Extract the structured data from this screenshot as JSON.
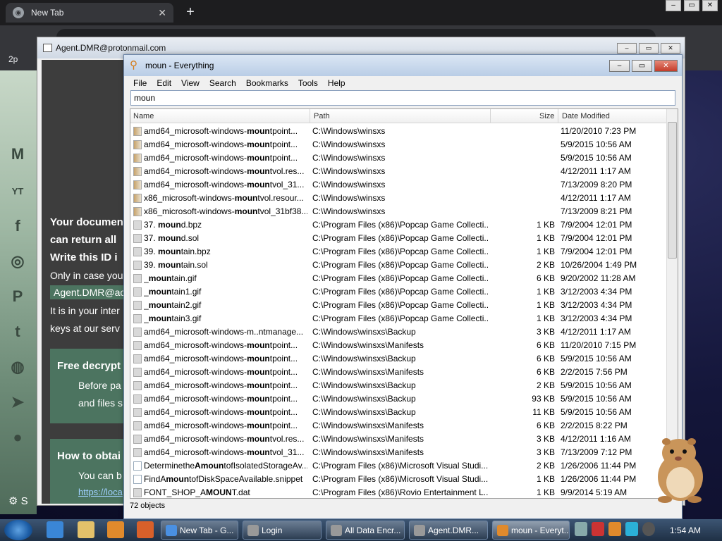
{
  "browser": {
    "tab_title": "New Tab",
    "bookmark_label": "2p"
  },
  "background_page": {
    "settings_label": "S",
    "lines": [
      "Your documen",
      "can return all",
      "Write this ID i",
      "Only in case you",
      "Agent.DMR@ao",
      "It is in your inter",
      "keys at our serv"
    ],
    "free_box": {
      "title": "Free decrypt",
      "line1": "Before pa",
      "line2": "and files s"
    },
    "how_box": {
      "title": "How to obtai",
      "line1": "You can b",
      "line2": "https://loca"
    }
  },
  "agent_window": {
    "title": "Agent.DMR@protonmail.com"
  },
  "everything": {
    "title": "moun - Everything",
    "menu": [
      "File",
      "Edit",
      "View",
      "Search",
      "Bookmarks",
      "Tools",
      "Help"
    ],
    "search_value": "moun",
    "columns": {
      "name": "Name",
      "path": "Path",
      "size": "Size",
      "date": "Date Modified"
    },
    "rows": [
      {
        "pre": "amd64_microsoft-windows-",
        "hit": "moun",
        "post": "tpoint...",
        "path": "C:\\Windows\\winsxs",
        "size": "",
        "date": "11/20/2010 7:23 PM",
        "icon": "dll"
      },
      {
        "pre": "amd64_microsoft-windows-",
        "hit": "moun",
        "post": "tpoint...",
        "path": "C:\\Windows\\winsxs",
        "size": "",
        "date": "5/9/2015 10:56 AM",
        "icon": "dll"
      },
      {
        "pre": "amd64_microsoft-windows-",
        "hit": "moun",
        "post": "tpoint...",
        "path": "C:\\Windows\\winsxs",
        "size": "",
        "date": "5/9/2015 10:56 AM",
        "icon": "dll"
      },
      {
        "pre": "amd64_microsoft-windows-",
        "hit": "moun",
        "post": "tvol.res...",
        "path": "C:\\Windows\\winsxs",
        "size": "",
        "date": "4/12/2011 1:17 AM",
        "icon": "dll"
      },
      {
        "pre": "amd64_microsoft-windows-",
        "hit": "moun",
        "post": "tvol_31...",
        "path": "C:\\Windows\\winsxs",
        "size": "",
        "date": "7/13/2009 8:20 PM",
        "icon": "dll"
      },
      {
        "pre": "x86_microsoft-windows-",
        "hit": "moun",
        "post": "tvol.resour...",
        "path": "C:\\Windows\\winsxs",
        "size": "",
        "date": "4/12/2011 1:17 AM",
        "icon": "dll"
      },
      {
        "pre": "x86_microsoft-windows-",
        "hit": "moun",
        "post": "tvol_31bf38...",
        "path": "C:\\Windows\\winsxs",
        "size": "",
        "date": "7/13/2009 8:21 PM",
        "icon": "dll"
      },
      {
        "pre": "37. ",
        "hit": "moun",
        "post": "d.bpz",
        "path": "C:\\Program Files (x86)\\Popcap Game Collecti...",
        "size": "1 KB",
        "date": "7/9/2004 12:01 PM",
        "icon": "file"
      },
      {
        "pre": "37. ",
        "hit": "moun",
        "post": "d.sol",
        "path": "C:\\Program Files (x86)\\Popcap Game Collecti...",
        "size": "1 KB",
        "date": "7/9/2004 12:01 PM",
        "icon": "file"
      },
      {
        "pre": "39. ",
        "hit": "moun",
        "post": "tain.bpz",
        "path": "C:\\Program Files (x86)\\Popcap Game Collecti...",
        "size": "1 KB",
        "date": "7/9/2004 12:01 PM",
        "icon": "file"
      },
      {
        "pre": "39. ",
        "hit": "moun",
        "post": "tain.sol",
        "path": "C:\\Program Files (x86)\\Popcap Game Collecti...",
        "size": "2 KB",
        "date": "10/26/2004 1:49 PM",
        "icon": "file"
      },
      {
        "pre": "_",
        "hit": "moun",
        "post": "tain.gif",
        "path": "C:\\Program Files (x86)\\Popcap Game Collecti...",
        "size": "6 KB",
        "date": "9/20/2002 11:28 AM",
        "icon": "file"
      },
      {
        "pre": "_",
        "hit": "moun",
        "post": "tain1.gif",
        "path": "C:\\Program Files (x86)\\Popcap Game Collecti...",
        "size": "1 KB",
        "date": "3/12/2003 4:34 PM",
        "icon": "file"
      },
      {
        "pre": "_",
        "hit": "moun",
        "post": "tain2.gif",
        "path": "C:\\Program Files (x86)\\Popcap Game Collecti...",
        "size": "1 KB",
        "date": "3/12/2003 4:34 PM",
        "icon": "file"
      },
      {
        "pre": "_",
        "hit": "moun",
        "post": "tain3.gif",
        "path": "C:\\Program Files (x86)\\Popcap Game Collecti...",
        "size": "1 KB",
        "date": "3/12/2003 4:34 PM",
        "icon": "file"
      },
      {
        "pre": "amd64_microsoft-windows-m..ntmanage...",
        "hit": "",
        "post": "",
        "path": "C:\\Windows\\winsxs\\Backup",
        "size": "3 KB",
        "date": "4/12/2011 1:17 AM",
        "icon": "file"
      },
      {
        "pre": "amd64_microsoft-windows-",
        "hit": "moun",
        "post": "tpoint...",
        "path": "C:\\Windows\\winsxs\\Manifests",
        "size": "6 KB",
        "date": "11/20/2010 7:15 PM",
        "icon": "file"
      },
      {
        "pre": "amd64_microsoft-windows-",
        "hit": "moun",
        "post": "tpoint...",
        "path": "C:\\Windows\\winsxs\\Backup",
        "size": "6 KB",
        "date": "5/9/2015 10:56 AM",
        "icon": "file"
      },
      {
        "pre": "amd64_microsoft-windows-",
        "hit": "moun",
        "post": "tpoint...",
        "path": "C:\\Windows\\winsxs\\Manifests",
        "size": "6 KB",
        "date": "2/2/2015 7:56 PM",
        "icon": "file"
      },
      {
        "pre": "amd64_microsoft-windows-",
        "hit": "moun",
        "post": "tpoint...",
        "path": "C:\\Windows\\winsxs\\Backup",
        "size": "2 KB",
        "date": "5/9/2015 10:56 AM",
        "icon": "file"
      },
      {
        "pre": "amd64_microsoft-windows-",
        "hit": "moun",
        "post": "tpoint...",
        "path": "C:\\Windows\\winsxs\\Backup",
        "size": "93 KB",
        "date": "5/9/2015 10:56 AM",
        "icon": "file"
      },
      {
        "pre": "amd64_microsoft-windows-",
        "hit": "moun",
        "post": "tpoint...",
        "path": "C:\\Windows\\winsxs\\Backup",
        "size": "11 KB",
        "date": "5/9/2015 10:56 AM",
        "icon": "file"
      },
      {
        "pre": "amd64_microsoft-windows-",
        "hit": "moun",
        "post": "tpoint...",
        "path": "C:\\Windows\\winsxs\\Manifests",
        "size": "6 KB",
        "date": "2/2/2015 8:22 PM",
        "icon": "file"
      },
      {
        "pre": "amd64_microsoft-windows-",
        "hit": "moun",
        "post": "tvol.res...",
        "path": "C:\\Windows\\winsxs\\Manifests",
        "size": "3 KB",
        "date": "4/12/2011 1:16 AM",
        "icon": "file"
      },
      {
        "pre": "amd64_microsoft-windows-",
        "hit": "moun",
        "post": "tvol_31...",
        "path": "C:\\Windows\\winsxs\\Manifests",
        "size": "3 KB",
        "date": "7/13/2009 7:12 PM",
        "icon": "file"
      },
      {
        "pre": "Determinethe",
        "hit": "Amoun",
        "post": "tofIsolatedStorageAv...",
        "path": "C:\\Program Files (x86)\\Microsoft Visual Studi...",
        "size": "2 KB",
        "date": "1/26/2006 11:44 PM",
        "icon": "doc"
      },
      {
        "pre": "FindA",
        "hit": "moun",
        "post": "tofDiskSpaceAvailable.snippet",
        "path": "C:\\Program Files (x86)\\Microsoft Visual Studi...",
        "size": "1 KB",
        "date": "1/26/2006 11:44 PM",
        "icon": "doc"
      },
      {
        "pre": "FONT_SHOP_A",
        "hit": "MOUN",
        "post": "T.dat",
        "path": "C:\\Program Files (x86)\\Rovio Entertainment L...",
        "size": "1 KB",
        "date": "9/9/2014 5:19 AM",
        "icon": "file"
      }
    ],
    "status": "72 objects"
  },
  "taskbar": {
    "buttons": [
      "New Tab - G...",
      "Login",
      "All Data Encr...",
      "Agent.DMR...",
      "moun - Everyt..."
    ],
    "clock": "1:54 AM"
  },
  "colors": {
    "accent": "#2f62b8",
    "chrome_dark": "#35363a",
    "green_box": "#4c7460"
  }
}
